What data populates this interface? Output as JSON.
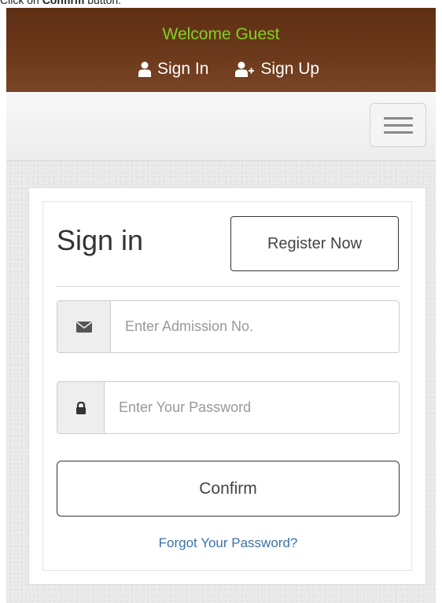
{
  "instruction": {
    "prefix": "Click on ",
    "target": "Confirm",
    "suffix": " button."
  },
  "header": {
    "welcome": "Welcome Guest",
    "sign_in": "Sign In",
    "sign_up": "Sign Up",
    "sign_in_icon": "user-icon",
    "sign_up_icon": "user-plus-icon"
  },
  "navbar": {
    "menu_icon": "hamburger-icon"
  },
  "form": {
    "title": "Sign in",
    "register_label": "Register Now",
    "admission_placeholder": "Enter Admission No.",
    "admission_icon": "envelope-icon",
    "password_placeholder": "Enter Your Password",
    "password_icon": "lock-icon",
    "confirm_label": "Confirm",
    "forgot_label": "Forgot Your Password?"
  },
  "colors": {
    "header_bg": "#6d3a1c",
    "welcome_text": "#7ed321",
    "link": "#3b72a8"
  }
}
